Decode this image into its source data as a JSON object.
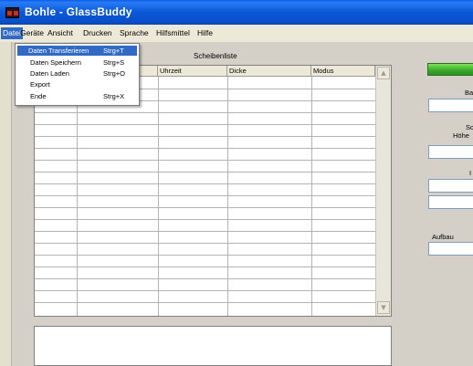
{
  "window": {
    "title": "Bohle - GlassBuddy"
  },
  "menubar": {
    "items": [
      "Datei",
      "Geräte",
      "Ansicht",
      "Drucken",
      "Sprache",
      "Hilfsmittel",
      "Hilfe"
    ]
  },
  "file_menu": {
    "items": [
      {
        "label": "Daten Transferieren",
        "shortcut": "Strg+T"
      },
      {
        "label": "Daten Speichern",
        "shortcut": "Strg+S"
      },
      {
        "label": "Daten Laden",
        "shortcut": "Strg+O"
      },
      {
        "label": "Export",
        "shortcut": ""
      },
      {
        "label": "Ende",
        "shortcut": "Strg+X"
      }
    ]
  },
  "list": {
    "title": "Scheibenliste",
    "columns": [
      "",
      "",
      "Uhrzeit",
      "Dicke",
      "Modus"
    ]
  },
  "right_panel": {
    "label_ba": "Ba",
    "label_sc": "Sc",
    "label_hoehe": "Höhe",
    "label_i": "I",
    "label_aufbau": "Aufbau"
  },
  "colors": {
    "titlebar": "#0a5de8",
    "highlight": "#316ac5",
    "status_green": "#3aa82a"
  }
}
